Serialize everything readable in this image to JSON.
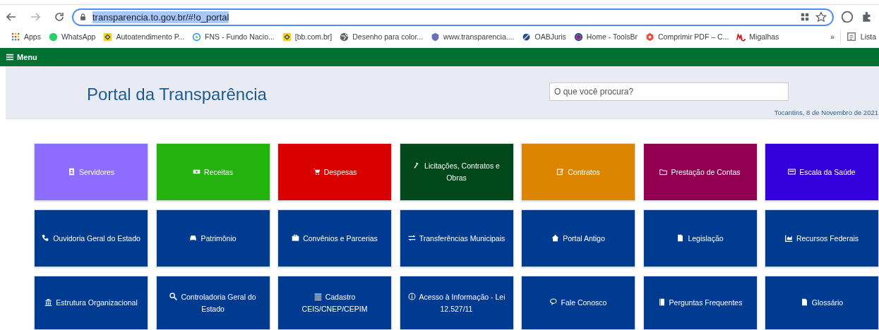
{
  "browser": {
    "url": "transparencia.to.gov.br/#!o_portal",
    "url_selected": true,
    "bookmarks": [
      {
        "label": "Apps"
      },
      {
        "label": "WhatsApp"
      },
      {
        "label": "Autoatendimento P..."
      },
      {
        "label": "FNS - Fundo Nacio..."
      },
      {
        "label": "[bb.com.br]"
      },
      {
        "label": "Desenho para color..."
      },
      {
        "label": "www.transparencia...."
      },
      {
        "label": "OABJuris"
      },
      {
        "label": "Home - ToolsBr"
      },
      {
        "label": "Comprimir PDF – C..."
      },
      {
        "label": "Migalhas"
      }
    ],
    "overflow": "»",
    "reading_list": "Lista"
  },
  "menu_bar": {
    "label": "Menu"
  },
  "header": {
    "title": "Portal da Transparência",
    "search": {
      "placeholder": "O que você procura?"
    },
    "date": "Tocantins, 8 de Novembro de 2021"
  },
  "tiles": [
    {
      "label": "Servidores",
      "color": "#8c6dfd"
    },
    {
      "label": "Receitas",
      "color": "#22b40c"
    },
    {
      "label": "Despesas",
      "color": "#d90000"
    },
    {
      "label": "Licitações, Contratos e Obras",
      "color": "#00481a"
    },
    {
      "label": "Contratos",
      "color": "#dd8400"
    },
    {
      "label": "Prestação de Contas",
      "color": "#930052"
    },
    {
      "label": "Escala da Saúde",
      "color": "#3300dd"
    },
    {
      "label": "Ouvidoria Geral do Estado",
      "color": "#003b92"
    },
    {
      "label": "Patrimônio",
      "color": "#003b92"
    },
    {
      "label": "Convênios e Parcerias",
      "color": "#003b92"
    },
    {
      "label": "Transferências Municipais",
      "color": "#003b92"
    },
    {
      "label": "Portal Antigo",
      "color": "#003b92"
    },
    {
      "label": "Legislação",
      "color": "#003b92"
    },
    {
      "label": "Recursos Federais",
      "color": "#003b92"
    },
    {
      "label": "Estrutura Organizacional",
      "color": "#003b92"
    },
    {
      "label": "Controladoria Geral do Estado",
      "color": "#003b92"
    },
    {
      "label": "Cadastro CEIS/CNEP/CEPIM",
      "color": "#003b92"
    },
    {
      "label": "Acesso à Informação - Lei 12.527/11",
      "color": "#003b92"
    },
    {
      "label": "Fale Conosco",
      "color": "#003b92"
    },
    {
      "label": "Perguntas Frequentes",
      "color": "#003b92"
    },
    {
      "label": "Glossário",
      "color": "#003b92"
    }
  ]
}
